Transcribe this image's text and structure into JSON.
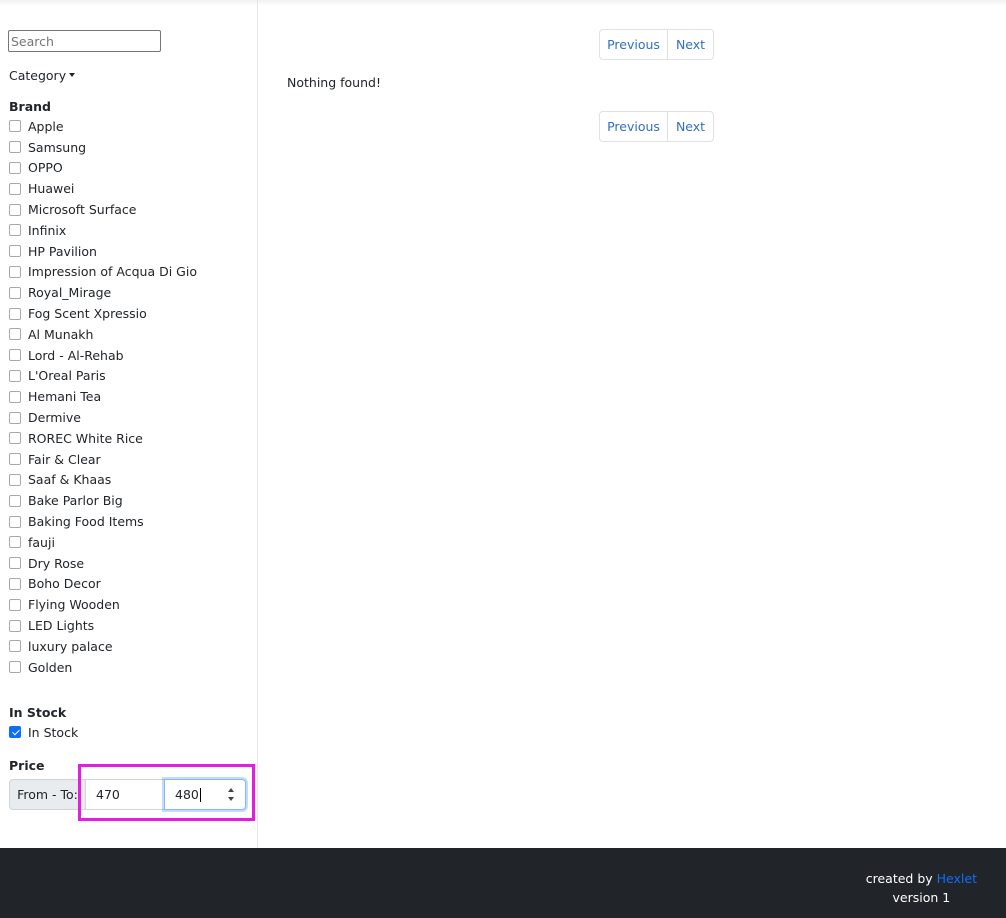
{
  "search": {
    "placeholder": "Search"
  },
  "category": {
    "label": "Category"
  },
  "brand": {
    "heading": "Brand",
    "items": [
      {
        "label": "Apple",
        "checked": false
      },
      {
        "label": "Samsung",
        "checked": false
      },
      {
        "label": "OPPO",
        "checked": false
      },
      {
        "label": "Huawei",
        "checked": false
      },
      {
        "label": "Microsoft Surface",
        "checked": false
      },
      {
        "label": "Infinix",
        "checked": false
      },
      {
        "label": "HP Pavilion",
        "checked": false
      },
      {
        "label": "Impression of Acqua Di Gio",
        "checked": false
      },
      {
        "label": "Royal_Mirage",
        "checked": false
      },
      {
        "label": "Fog Scent Xpressio",
        "checked": false
      },
      {
        "label": "Al Munakh",
        "checked": false
      },
      {
        "label": "Lord - Al-Rehab",
        "checked": false
      },
      {
        "label": "L'Oreal Paris",
        "checked": false
      },
      {
        "label": "Hemani Tea",
        "checked": false
      },
      {
        "label": "Dermive",
        "checked": false
      },
      {
        "label": "ROREC White Rice",
        "checked": false
      },
      {
        "label": "Fair & Clear",
        "checked": false
      },
      {
        "label": "Saaf & Khaas",
        "checked": false
      },
      {
        "label": "Bake Parlor Big",
        "checked": false
      },
      {
        "label": "Baking Food Items",
        "checked": false
      },
      {
        "label": "fauji",
        "checked": false
      },
      {
        "label": "Dry Rose",
        "checked": false
      },
      {
        "label": "Boho Decor",
        "checked": false
      },
      {
        "label": "Flying Wooden",
        "checked": false
      },
      {
        "label": "LED Lights",
        "checked": false
      },
      {
        "label": "luxury palace",
        "checked": false
      },
      {
        "label": "Golden",
        "checked": false
      }
    ]
  },
  "stock": {
    "heading": "In Stock",
    "label": "In Stock",
    "checked": true
  },
  "price": {
    "heading": "Price",
    "prefix": "From - To:",
    "from": "470",
    "to": "480"
  },
  "pagination": {
    "previous": "Previous",
    "next": "Next"
  },
  "results": {
    "message": "Nothing found!"
  },
  "footer": {
    "created_by": "created by",
    "link": "Hexlet",
    "version": "version 1"
  },
  "colors": {
    "accent": "#0d6efd",
    "footer_bg": "#212529",
    "highlight": "#e31ee0",
    "link": "#2f6fc4"
  }
}
